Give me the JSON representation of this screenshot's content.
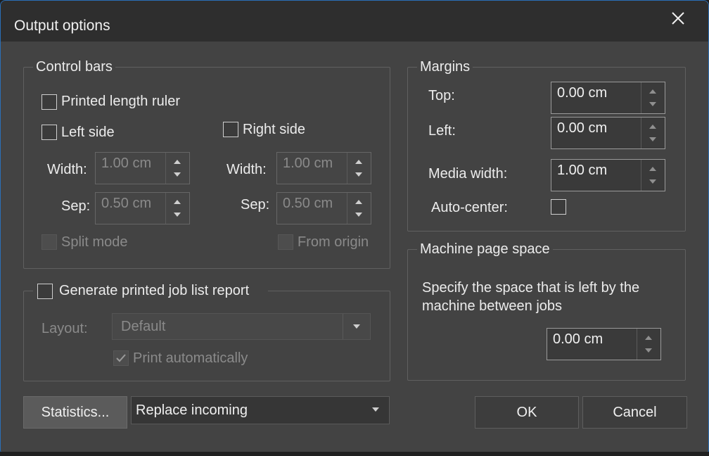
{
  "window": {
    "title": "Output options"
  },
  "control_bars": {
    "legend": "Control bars",
    "printed_length_ruler": {
      "label": "Printed length ruler",
      "checked": false
    },
    "left_side": {
      "label": "Left side",
      "checked": false
    },
    "right_side": {
      "label": "Right side",
      "checked": false
    },
    "left_width": {
      "label": "Width:",
      "value": "1.00 cm"
    },
    "left_sep": {
      "label": "Sep:",
      "value": "0.50 cm"
    },
    "right_width": {
      "label": "Width:",
      "value": "1.00 cm"
    },
    "right_sep": {
      "label": "Sep:",
      "value": "0.50 cm"
    },
    "split_mode": {
      "label": "Split mode",
      "checked": false
    },
    "from_origin": {
      "label": "From origin",
      "checked": false
    }
  },
  "job_list_report": {
    "legend": "Generate printed job list report",
    "checked": false,
    "layout_label": "Layout:",
    "layout_value": "Default",
    "print_automatically": {
      "label": "Print automatically",
      "checked": true
    }
  },
  "margins": {
    "legend": "Margins",
    "top": {
      "label": "Top:",
      "value": "0.00 cm"
    },
    "left": {
      "label": "Left:",
      "value": "0.00 cm"
    },
    "media_width": {
      "label": "Media width:",
      "value": "1.00 cm"
    },
    "auto_center": {
      "label": "Auto-center:",
      "checked": false
    }
  },
  "machine_page_space": {
    "legend": "Machine page space",
    "description": "Specify the space that is left by the machine between jobs",
    "value": "0.00 cm"
  },
  "footer": {
    "statistics_label": "Statistics...",
    "mode_value": "Replace incoming",
    "ok_label": "OK",
    "cancel_label": "Cancel"
  },
  "icons": {
    "close": "close-icon",
    "check": "check-icon",
    "spin_up": "chevron-up-icon",
    "spin_down": "chevron-down-icon",
    "dropdown": "dropdown-arrow-icon"
  }
}
